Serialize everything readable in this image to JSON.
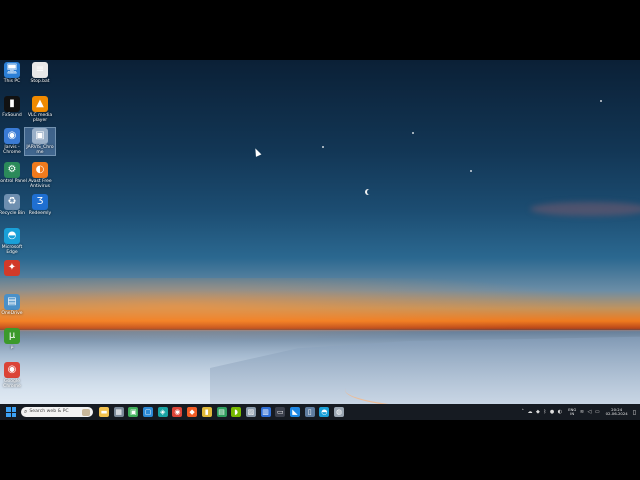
{
  "desktop": {
    "icons": [
      {
        "id": "this-pc",
        "label": "This PC",
        "glyph": "🖥",
        "color": "#2b7fd6",
        "icon": "monitor-icon"
      },
      {
        "id": "stop-bat",
        "label": "Stop.bat",
        "glyph": "≡",
        "color": "#e8e8e8",
        "icon": "text-file-icon"
      },
      {
        "id": "fxsound",
        "label": "FxSound",
        "glyph": "▮",
        "color": "#111111",
        "icon": "audio-bars-icon"
      },
      {
        "id": "vlc",
        "label": "VLC media player",
        "glyph": "▲",
        "color": "#f08a00",
        "icon": "traffic-cone-icon"
      },
      {
        "id": "jarvis-chrome",
        "label": "Jarvis - Chrome",
        "glyph": "◉",
        "color": "#3a7bd5",
        "icon": "chrome-profile-icon"
      },
      {
        "id": "jarvis-shortcut",
        "label": "JARVIS_Chrome",
        "glyph": "▣",
        "color": "#9ab0c8",
        "icon": "shortcut-image-icon"
      },
      {
        "id": "control-panel",
        "label": "Control Panel",
        "glyph": "⚙",
        "color": "#2b8a5a",
        "icon": "control-panel-icon"
      },
      {
        "id": "avast-free",
        "label": "Avast Free Antivirus",
        "glyph": "◐",
        "color": "#f07b1e",
        "icon": "antivirus-icon"
      },
      {
        "id": "recycle-bin",
        "label": "Recycle Bin",
        "glyph": "♻",
        "color": "#6e8fb0",
        "icon": "recycle-bin-icon"
      },
      {
        "id": "redeemly",
        "label": "Redeemly",
        "glyph": "Ʒ",
        "color": "#1f6fd1",
        "icon": "app-z-icon"
      },
      {
        "id": "edge",
        "label": "Microsoft Edge",
        "glyph": "◓",
        "color": "#1aa0d8",
        "icon": "edge-icon"
      },
      {
        "id": "app-red",
        "label": "",
        "glyph": "✦",
        "color": "#d13a2a",
        "icon": "app-star-icon"
      },
      {
        "id": "drive",
        "label": "OneDrive",
        "glyph": "▤",
        "color": "#4a90c8",
        "icon": "drive-icon"
      },
      {
        "id": "utorrent",
        "label": "µ",
        "glyph": "µ",
        "color": "#3c9a2b",
        "icon": "utorrent-icon"
      },
      {
        "id": "chrome",
        "label": "Google Chrome",
        "glyph": "◉",
        "color": "#db4437",
        "icon": "chrome-icon"
      }
    ]
  },
  "taskbar": {
    "search_placeholder": "Search web & PC",
    "apps": [
      {
        "icon": "file-explorer-icon",
        "color": "#f2c14e",
        "glyph": "▬"
      },
      {
        "icon": "app-grid-icon",
        "color": "#7b8a99",
        "glyph": "▦"
      },
      {
        "icon": "app-green-icon",
        "color": "#3fae5b",
        "glyph": "▣"
      },
      {
        "icon": "task-view-icon",
        "color": "#2b8ad6",
        "glyph": "▢"
      },
      {
        "icon": "app-teal-icon",
        "color": "#19a3a3",
        "glyph": "◈"
      },
      {
        "icon": "chrome-icon",
        "color": "#db4437",
        "glyph": "◉"
      },
      {
        "icon": "brave-icon",
        "color": "#f25c24",
        "glyph": "◆"
      },
      {
        "icon": "app-yellow-icon",
        "color": "#e0b93a",
        "glyph": "▮"
      },
      {
        "icon": "app-green-doc-icon",
        "color": "#2f9e5e",
        "glyph": "▤"
      },
      {
        "icon": "nvidia-icon",
        "color": "#76b900",
        "glyph": "◗"
      },
      {
        "icon": "app-gray-icon",
        "color": "#8899aa",
        "glyph": "▨"
      },
      {
        "icon": "app-blue-icon",
        "color": "#2f6fd6",
        "glyph": "▥"
      },
      {
        "icon": "terminal-icon",
        "color": "#3a3f4b",
        "glyph": "▭"
      },
      {
        "icon": "vscode-icon",
        "color": "#1e88e5",
        "glyph": "◣"
      },
      {
        "icon": "app-doc-icon",
        "color": "#5f7da0",
        "glyph": "▯"
      },
      {
        "icon": "edge-icon",
        "color": "#1aa0d8",
        "glyph": "◓"
      },
      {
        "icon": "app-globe-icon",
        "color": "#9aa6b2",
        "glyph": "◍"
      }
    ],
    "tray": {
      "icons": [
        "chevron-up-icon",
        "cloud-icon",
        "security-icon",
        "bluetooth-icon",
        "app-tray-icon",
        "antivirus-tray-icon",
        "battery-icon"
      ],
      "lang_top": "ENG",
      "lang_bottom": "IN",
      "right_icons": [
        "wifi-icon",
        "volume-icon",
        "power-icon"
      ],
      "time": "20:24",
      "date": "02-06-2024"
    }
  }
}
